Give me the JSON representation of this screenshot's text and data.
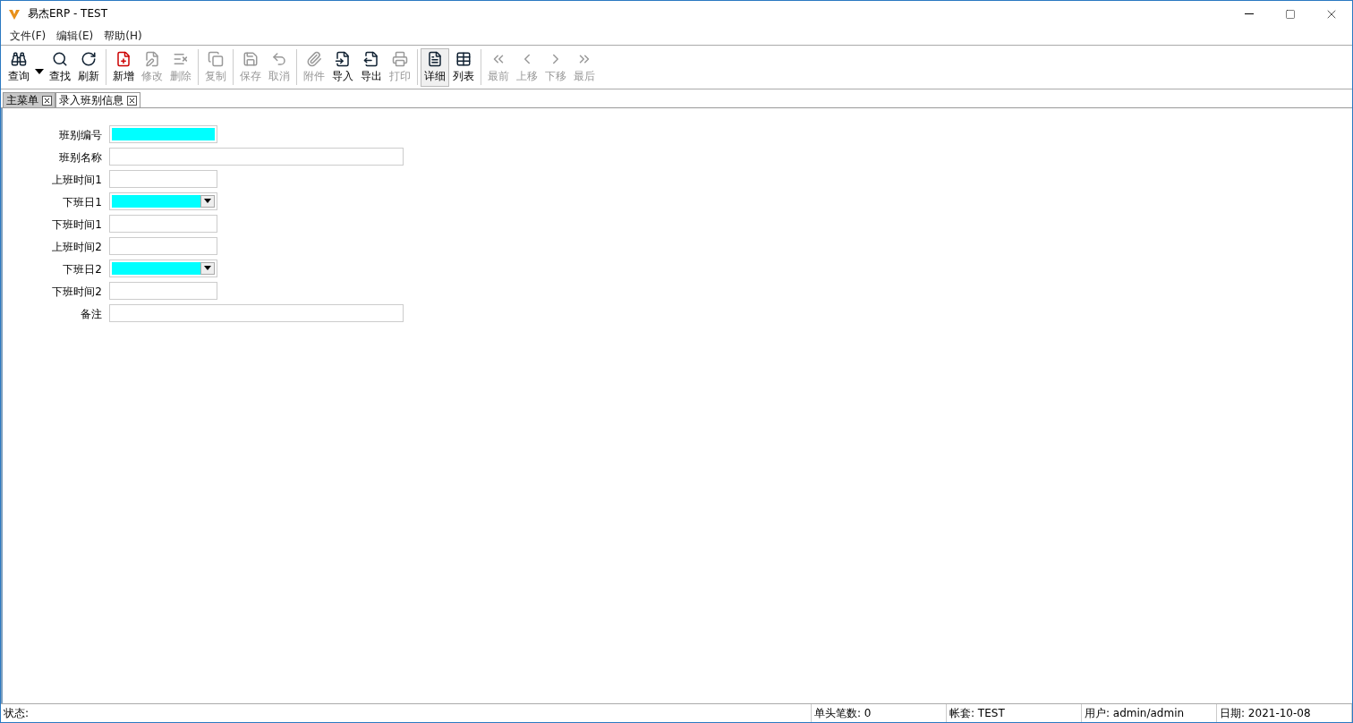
{
  "window": {
    "title": "易杰ERP - TEST"
  },
  "menu": [
    "文件(F)",
    "编辑(E)",
    "帮助(H)"
  ],
  "toolbar": [
    [
      {
        "label": "查询",
        "disabled": false,
        "pressed": false,
        "dropdown": true
      },
      {
        "label": "查找",
        "disabled": false,
        "pressed": false
      },
      {
        "label": "刷新",
        "disabled": false,
        "pressed": false
      }
    ],
    [
      {
        "label": "新增",
        "disabled": false,
        "pressed": false
      },
      {
        "label": "修改",
        "disabled": true,
        "pressed": false
      },
      {
        "label": "删除",
        "disabled": true,
        "pressed": false
      }
    ],
    [
      {
        "label": "复制",
        "disabled": true,
        "pressed": false
      }
    ],
    [
      {
        "label": "保存",
        "disabled": true,
        "pressed": false
      },
      {
        "label": "取消",
        "disabled": true,
        "pressed": false
      }
    ],
    [
      {
        "label": "附件",
        "disabled": true,
        "pressed": false
      },
      {
        "label": "导入",
        "disabled": false,
        "pressed": false
      },
      {
        "label": "导出",
        "disabled": false,
        "pressed": false
      },
      {
        "label": "打印",
        "disabled": true,
        "pressed": false
      }
    ],
    [
      {
        "label": "详细",
        "disabled": false,
        "pressed": true
      },
      {
        "label": "列表",
        "disabled": false,
        "pressed": false
      }
    ],
    [
      {
        "label": "最前",
        "disabled": true,
        "pressed": false
      },
      {
        "label": "上移",
        "disabled": true,
        "pressed": false
      },
      {
        "label": "下移",
        "disabled": true,
        "pressed": false
      },
      {
        "label": "最后",
        "disabled": true,
        "pressed": false
      }
    ]
  ],
  "tabs": [
    {
      "label": "主菜单",
      "selected": false
    },
    {
      "label": "录入班别信息",
      "selected": true
    }
  ],
  "form": [
    {
      "label": "班别编号",
      "kind": "text",
      "wide": false,
      "required": true
    },
    {
      "label": "班别名称",
      "kind": "text",
      "wide": true,
      "required": false
    },
    {
      "label": "上班时间1",
      "kind": "text",
      "wide": false,
      "required": false
    },
    {
      "label": "下班日1",
      "kind": "combo",
      "wide": false,
      "required": true
    },
    {
      "label": "下班时间1",
      "kind": "text",
      "wide": false,
      "required": false
    },
    {
      "label": "上班时间2",
      "kind": "text",
      "wide": false,
      "required": false
    },
    {
      "label": "下班日2",
      "kind": "combo",
      "wide": false,
      "required": true
    },
    {
      "label": "下班时间2",
      "kind": "text",
      "wide": false,
      "required": false
    },
    {
      "label": "备注",
      "kind": "text",
      "wide": true,
      "required": false
    }
  ],
  "status_bar": [
    "状态:",
    "单头笔数: 0",
    "帐套: TEST",
    "用户: admin/admin",
    "日期: 2021-10-08"
  ]
}
